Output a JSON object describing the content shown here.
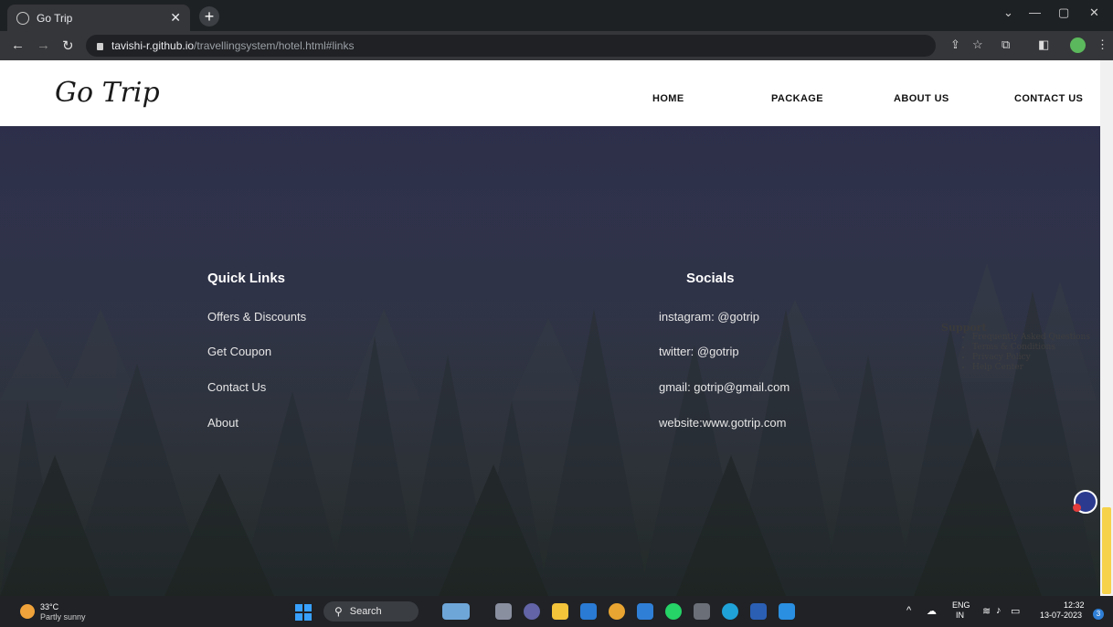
{
  "browser": {
    "tab_title": "Go Trip",
    "url_host": "tavishi-r.github.io",
    "url_path": "/travellingsystem/hotel.html#links"
  },
  "site": {
    "logo": "Go Trip",
    "menu": [
      "HOME",
      "PACKAGE",
      "ABOUT US",
      "CONTACT US"
    ]
  },
  "footer": {
    "quick_links": {
      "title": "Quick Links",
      "items": [
        "Offers & Discounts",
        "Get Coupon",
        "Contact Us",
        "About"
      ]
    },
    "socials": {
      "title": "Socials",
      "items": [
        "instagram: @gotrip",
        "twitter: @gotrip",
        "gmail: gotrip@gmail.com",
        "website:www.gotrip.com"
      ]
    },
    "support": {
      "title": "Support",
      "items": [
        "Frequently Asked Questions",
        "Terms & Conditions",
        "Privacy Policy",
        "Help Center"
      ]
    }
  },
  "taskbar": {
    "weather_temp": "33°C",
    "weather_desc": "Partly sunny",
    "search_label": "Search",
    "lang": "ENG",
    "region": "IN",
    "time": "12:32",
    "date": "13-07-2023",
    "notification_count": "3"
  },
  "colors": {
    "accent": "#f6d24a",
    "hero_dark": "#2d2f4a",
    "link_text": "#e6e6e6"
  }
}
